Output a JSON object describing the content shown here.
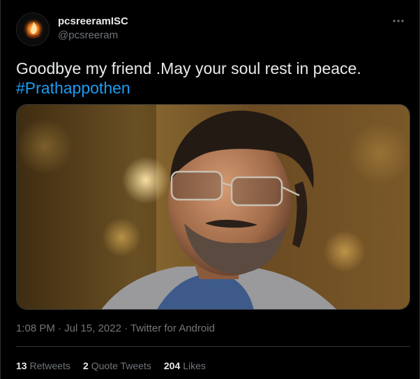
{
  "user": {
    "display_name": "pcsreeramISC",
    "handle": "@pcsreeram",
    "avatar_icon": "flame-logo-icon"
  },
  "tweet": {
    "text": "Goodbye my friend .May your soul rest in peace.",
    "hashtag": "#Prathappothen"
  },
  "media": {
    "description_icon": "photo"
  },
  "meta": {
    "time": "1:08 PM",
    "separator": " · ",
    "date": "Jul 15, 2022",
    "source": "Twitter for Android"
  },
  "stats": {
    "retweets_count": "13",
    "retweets_label": "Retweets",
    "quotes_count": "2",
    "quotes_label": "Quote Tweets",
    "likes_count": "204",
    "likes_label": "Likes"
  },
  "colors": {
    "background": "#000000",
    "text": "#e7e9ea",
    "muted": "#71767b",
    "accent": "#1d9bf0",
    "border": "#2f3336"
  }
}
